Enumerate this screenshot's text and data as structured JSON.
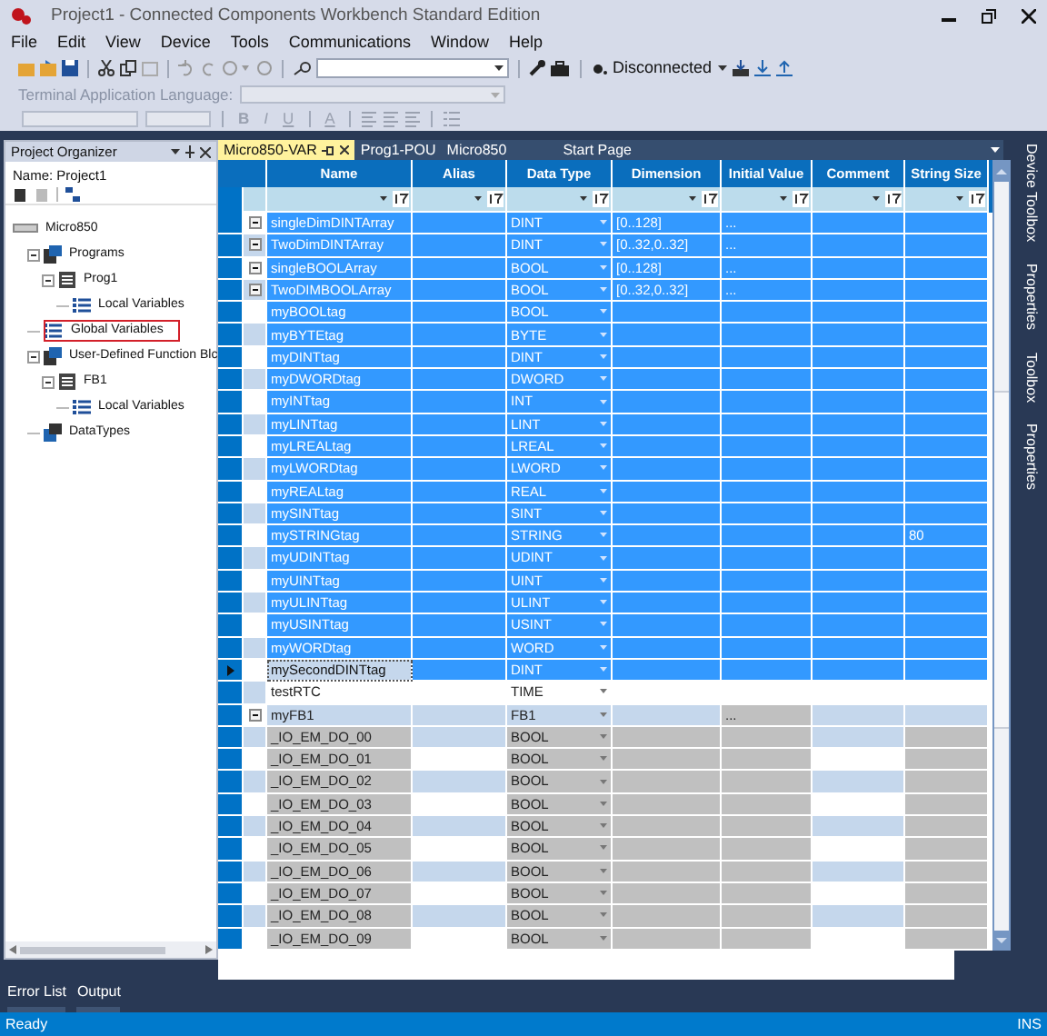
{
  "window": {
    "title": "Project1 - Connected Components Workbench Standard Edition"
  },
  "menu": [
    "File",
    "Edit",
    "View",
    "Device",
    "Tools",
    "Communications",
    "Window",
    "Help"
  ],
  "toolbar": {
    "connection": "Disconnected",
    "terminal_label": "Terminal Application Language:",
    "format_buttons": [
      "B",
      "I",
      "U",
      "A"
    ]
  },
  "project_organizer": {
    "title": "Project Organizer",
    "name_label": "Name: Project1",
    "tree": [
      {
        "label": "Micro850",
        "kind": "device",
        "highlighted": false,
        "children": [
          {
            "label": "Programs",
            "kind": "folder",
            "expanded": true,
            "highlighted": false,
            "children": [
              {
                "label": "Prog1",
                "kind": "program",
                "expanded": true,
                "highlighted": false,
                "children": [
                  {
                    "label": "Local Variables",
                    "kind": "variables",
                    "highlighted": false
                  }
                ]
              }
            ]
          },
          {
            "label": "Global Variables",
            "kind": "variables",
            "highlighted": true
          },
          {
            "label": "User-Defined Function Blc",
            "kind": "folder",
            "expanded": true,
            "highlighted": false,
            "children": [
              {
                "label": "FB1",
                "kind": "program",
                "expanded": true,
                "highlighted": false,
                "children": [
                  {
                    "label": "Local Variables",
                    "kind": "variables",
                    "highlighted": false
                  }
                ]
              }
            ]
          },
          {
            "label": "DataTypes",
            "kind": "datatypes",
            "highlighted": false
          }
        ]
      }
    ]
  },
  "tabs": [
    {
      "label": "Micro850-VAR",
      "selected": true
    },
    {
      "label": "Prog1-POU",
      "selected": false
    },
    {
      "label": "Micro850",
      "selected": false
    },
    {
      "label": "Start Page",
      "selected": false
    }
  ],
  "grid": {
    "columns": [
      "Name",
      "Alias",
      "Data Type",
      "Dimension",
      "Initial Value",
      "Comment",
      "String Size"
    ],
    "rows": [
      {
        "name": "singleDimDINTArray",
        "data_type": "DINT",
        "dimension": "[0..128]",
        "initial_value": "...",
        "kind": "array",
        "selected": true,
        "current": false
      },
      {
        "name": "TwoDimDINTArray",
        "data_type": "DINT",
        "dimension": "[0..32,0..32]",
        "initial_value": "...",
        "kind": "array",
        "selected": true,
        "current": false
      },
      {
        "name": "singleBOOLArray",
        "data_type": "BOOL",
        "dimension": "[0..128]",
        "initial_value": "...",
        "kind": "array",
        "selected": true,
        "current": false
      },
      {
        "name": "TwoDIMBOOLArray",
        "data_type": "BOOL",
        "dimension": "[0..32,0..32]",
        "initial_value": "...",
        "kind": "array",
        "selected": true,
        "current": false
      },
      {
        "name": "myBOOLtag",
        "data_type": "BOOL",
        "kind": "tag",
        "selected": true,
        "current": false
      },
      {
        "name": "myBYTEtag",
        "data_type": "BYTE",
        "kind": "tag",
        "selected": true,
        "current": false
      },
      {
        "name": "myDINTtag",
        "data_type": "DINT",
        "kind": "tag",
        "selected": true,
        "current": false
      },
      {
        "name": "myDWORDtag",
        "data_type": "DWORD",
        "kind": "tag",
        "selected": true,
        "current": false
      },
      {
        "name": "myINTtag",
        "data_type": "INT",
        "kind": "tag",
        "selected": true,
        "current": false
      },
      {
        "name": "myLINTtag",
        "data_type": "LINT",
        "kind": "tag",
        "selected": true,
        "current": false
      },
      {
        "name": "myLREALtag",
        "data_type": "LREAL",
        "kind": "tag",
        "selected": true,
        "current": false
      },
      {
        "name": "myLWORDtag",
        "data_type": "LWORD",
        "kind": "tag",
        "selected": true,
        "current": false
      },
      {
        "name": "myREALtag",
        "data_type": "REAL",
        "kind": "tag",
        "selected": true,
        "current": false
      },
      {
        "name": "mySINTtag",
        "data_type": "SINT",
        "kind": "tag",
        "selected": true,
        "current": false
      },
      {
        "name": "mySTRINGtag",
        "data_type": "STRING",
        "string_size": "80",
        "kind": "tag",
        "selected": true,
        "current": false
      },
      {
        "name": "myUDINTtag",
        "data_type": "UDINT",
        "kind": "tag",
        "selected": true,
        "current": false
      },
      {
        "name": "myUINTtag",
        "data_type": "UINT",
        "kind": "tag",
        "selected": true,
        "current": false
      },
      {
        "name": "myULINTtag",
        "data_type": "ULINT",
        "kind": "tag",
        "selected": true,
        "current": false
      },
      {
        "name": "myUSINTtag",
        "data_type": "USINT",
        "kind": "tag",
        "selected": true,
        "current": false
      },
      {
        "name": "myWORDtag",
        "data_type": "WORD",
        "kind": "tag",
        "selected": true,
        "current": false
      },
      {
        "name": "mySecondDINTtag",
        "data_type": "DINT",
        "kind": "tag",
        "selected": true,
        "current": true
      },
      {
        "name": "testRTC",
        "data_type": "TIME",
        "kind": "tag",
        "selected": false,
        "current": false
      },
      {
        "name": "myFB1",
        "data_type": "FB1",
        "initial_value": "...",
        "kind": "fb",
        "selected": false,
        "current": false
      },
      {
        "name": "_IO_EM_DO_00",
        "data_type": "BOOL",
        "kind": "io",
        "selected": false,
        "current": false
      },
      {
        "name": "_IO_EM_DO_01",
        "data_type": "BOOL",
        "kind": "io",
        "selected": false,
        "current": false
      },
      {
        "name": "_IO_EM_DO_02",
        "data_type": "BOOL",
        "kind": "io",
        "selected": false,
        "current": false
      },
      {
        "name": "_IO_EM_DO_03",
        "data_type": "BOOL",
        "kind": "io",
        "selected": false,
        "current": false
      },
      {
        "name": "_IO_EM_DO_04",
        "data_type": "BOOL",
        "kind": "io",
        "selected": false,
        "current": false
      },
      {
        "name": "_IO_EM_DO_05",
        "data_type": "BOOL",
        "kind": "io",
        "selected": false,
        "current": false
      },
      {
        "name": "_IO_EM_DO_06",
        "data_type": "BOOL",
        "kind": "io",
        "selected": false,
        "current": false
      },
      {
        "name": "_IO_EM_DO_07",
        "data_type": "BOOL",
        "kind": "io",
        "selected": false,
        "current": false
      },
      {
        "name": "_IO_EM_DO_08",
        "data_type": "BOOL",
        "kind": "io",
        "selected": false,
        "current": false
      },
      {
        "name": "_IO_EM_DO_09",
        "data_type": "BOOL",
        "kind": "io",
        "selected": false,
        "current": false
      }
    ]
  },
  "side_tabs": [
    "Device Toolbox",
    "Properties",
    "Toolbox",
    "Properties"
  ],
  "bottom_tabs": [
    "Error List",
    "Output"
  ],
  "status_bar": {
    "message": "Ready",
    "mode": "INS"
  }
}
